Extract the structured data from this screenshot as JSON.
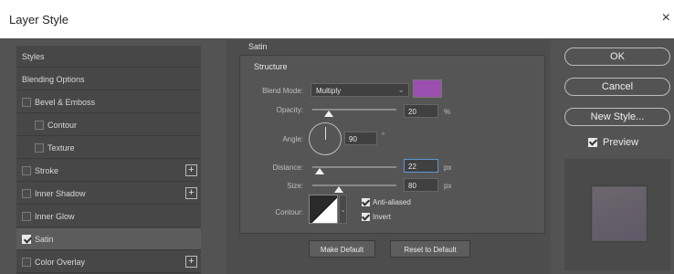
{
  "window": {
    "title": "Layer Style",
    "close_glyph": "×"
  },
  "styles_list": {
    "items": [
      {
        "label": "Styles",
        "checkbox": false,
        "checked": false,
        "indent": 0,
        "plus": false
      },
      {
        "label": "Blending Options",
        "checkbox": false,
        "checked": false,
        "indent": 0,
        "plus": false
      },
      {
        "label": "Bevel & Emboss",
        "checkbox": true,
        "checked": false,
        "indent": 0,
        "plus": false
      },
      {
        "label": "Contour",
        "checkbox": true,
        "checked": false,
        "indent": 1,
        "plus": false
      },
      {
        "label": "Texture",
        "checkbox": true,
        "checked": false,
        "indent": 1,
        "plus": false
      },
      {
        "label": "Stroke",
        "checkbox": true,
        "checked": false,
        "indent": 0,
        "plus": true
      },
      {
        "label": "Inner Shadow",
        "checkbox": true,
        "checked": false,
        "indent": 0,
        "plus": true
      },
      {
        "label": "Inner Glow",
        "checkbox": true,
        "checked": false,
        "indent": 0,
        "plus": false
      },
      {
        "label": "Satin",
        "checkbox": true,
        "checked": true,
        "indent": 0,
        "plus": false,
        "selected": true
      },
      {
        "label": "Color Overlay",
        "checkbox": true,
        "checked": false,
        "indent": 0,
        "plus": true
      }
    ],
    "plus_glyph": "+"
  },
  "satin": {
    "section_title": "Satin",
    "structure_title": "Structure",
    "blend_mode": {
      "label": "Blend Mode:",
      "value": "Multiply",
      "arrow": "⌄",
      "color": "#9b4fae"
    },
    "opacity": {
      "label": "Opacity:",
      "value": "20",
      "unit": "%",
      "fraction": 0.2
    },
    "angle": {
      "label": "Angle:",
      "value": "90",
      "unit": "°"
    },
    "distance": {
      "label": "Distance:",
      "value": "22",
      "unit": "px",
      "fraction": 0.09
    },
    "size": {
      "label": "Size:",
      "value": "80",
      "unit": "px",
      "fraction": 0.32
    },
    "contour": {
      "label": "Contour:",
      "arrow": "⌄"
    },
    "anti_aliased": {
      "label": "Anti-aliased",
      "checked": true
    },
    "invert": {
      "label": "Invert",
      "checked": true
    },
    "make_default": "Make Default",
    "reset_default": "Reset to Default"
  },
  "actions": {
    "ok": "OK",
    "cancel": "Cancel",
    "new_style": "New Style...",
    "preview": {
      "label": "Preview",
      "checked": true
    }
  }
}
